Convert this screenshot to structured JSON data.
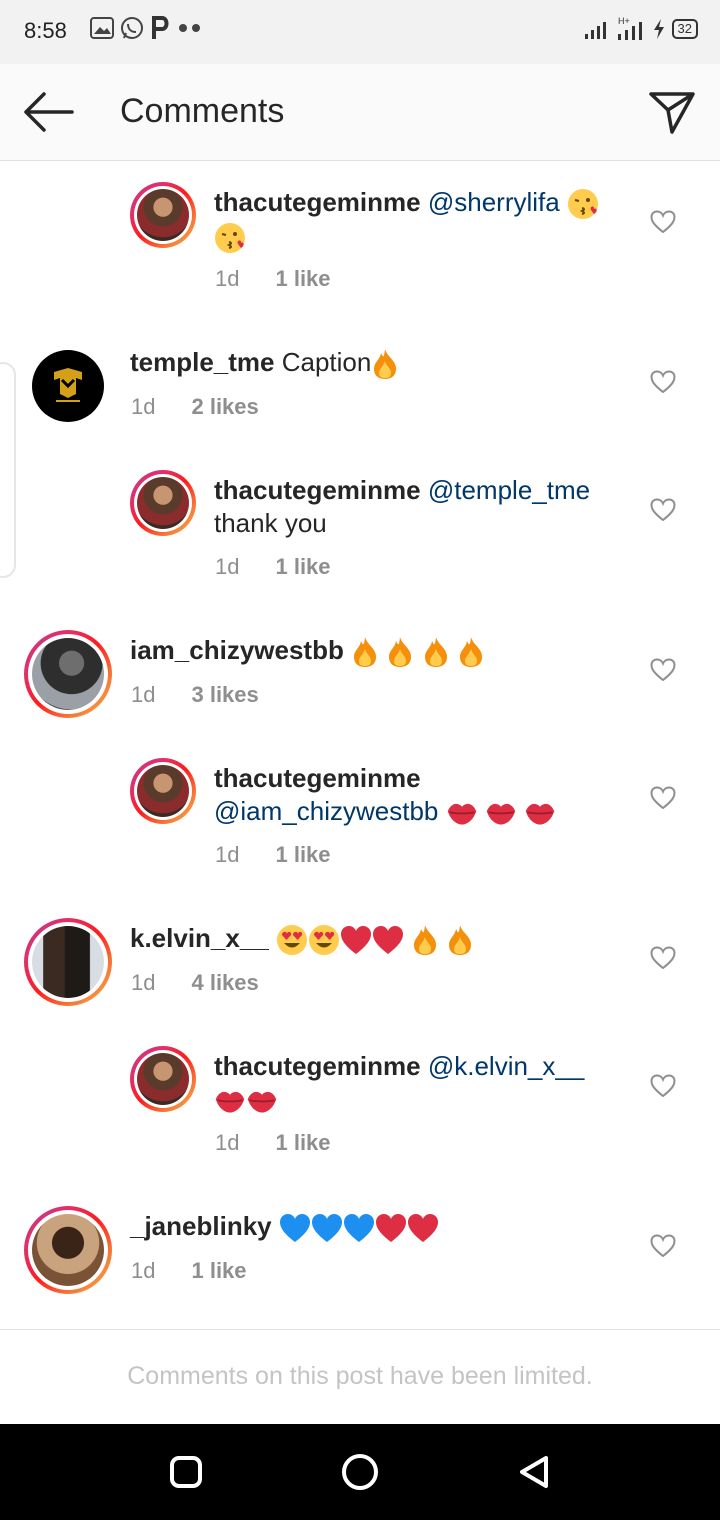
{
  "status": {
    "time": "8:58",
    "battery": "32",
    "left_icons": [
      "image-icon",
      "whatsapp-icon",
      "p-icon",
      "more-dots"
    ],
    "right_icons": [
      "signal-icon",
      "h-plus-signal-icon",
      "charging-icon",
      "battery-icon"
    ]
  },
  "header": {
    "title": "Comments"
  },
  "comments": [
    {
      "user": "thacutegeminme",
      "mention": "@sherrylifa",
      "text": "",
      "emoji": [
        "kiss",
        "kiss"
      ],
      "time": "1d",
      "likes": "1 like",
      "reply": true
    },
    {
      "user": "temple_tme",
      "mention": "",
      "text": "Caption",
      "emoji": [
        "fire"
      ],
      "time": "1d",
      "likes": "2 likes",
      "reply": false
    },
    {
      "user": "thacutegeminme",
      "mention": "@temple_tme",
      "text": "thank you",
      "emoji": [],
      "time": "1d",
      "likes": "1 like",
      "reply": true
    },
    {
      "user": "iam_chizywestbb",
      "mention": "",
      "text": "",
      "emoji": [
        "fire",
        "fire",
        "fire",
        "fire"
      ],
      "time": "1d",
      "likes": "3 likes",
      "reply": false
    },
    {
      "user": "thacutegeminme",
      "mention": "@iam_chizywestbb",
      "text": "",
      "emoji": [
        "lips",
        "lips",
        "lips"
      ],
      "time": "1d",
      "likes": "1 like",
      "reply": true
    },
    {
      "user": "k.elvin_x__",
      "mention": "",
      "text": "",
      "emoji": [
        "heart-eyes",
        "heart-eyes",
        "red-heart",
        "red-heart",
        "fire",
        "fire"
      ],
      "time": "1d",
      "likes": "4 likes",
      "reply": false
    },
    {
      "user": "thacutegeminme",
      "mention": "@k.elvin_x__",
      "text": "",
      "emoji": [
        "lips",
        "lips"
      ],
      "time": "1d",
      "likes": "1 like",
      "reply": true
    },
    {
      "user": "_janeblinky",
      "mention": "",
      "text": "",
      "emoji": [
        "blue-heart",
        "blue-heart",
        "blue-heart",
        "red-heart",
        "red-heart"
      ],
      "time": "1d",
      "likes": "1 like",
      "reply": false
    }
  ],
  "footer": {
    "limited_text": "Comments on this post have been limited."
  },
  "colors": {
    "mention": "#00376b",
    "meta": "#8e8e8e",
    "ring_start": "#c13584",
    "ring_end": "#fcaf45"
  }
}
